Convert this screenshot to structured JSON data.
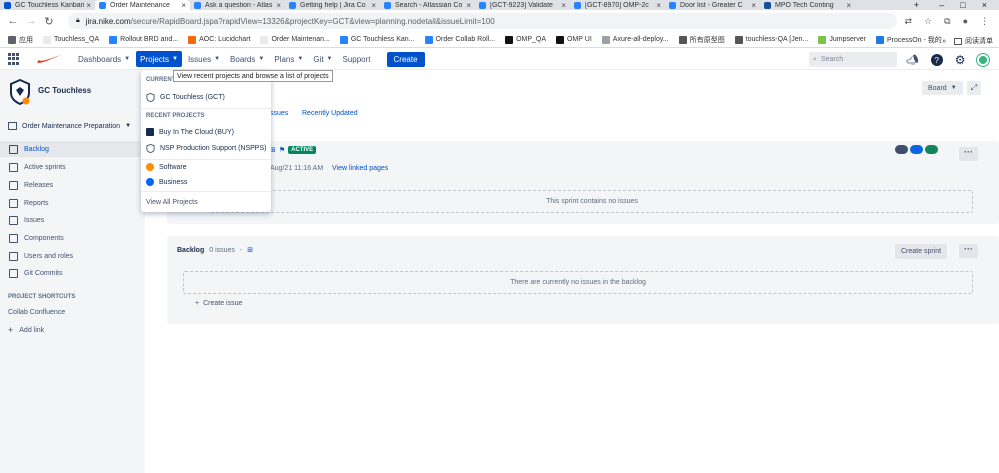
{
  "browser": {
    "tabs": [
      {
        "title": "GC Touchless Kanban",
        "color": "#0052cc",
        "active": false
      },
      {
        "title": "Order Maintenance",
        "color": "#2684ff",
        "active": true
      },
      {
        "title": "Ask a question - Atlas",
        "color": "#2684ff",
        "active": false
      },
      {
        "title": "Getting help | Jira Co",
        "color": "#2684ff",
        "active": false
      },
      {
        "title": "Search - Atlassian Co",
        "color": "#2684ff",
        "active": false
      },
      {
        "title": "[GCT-9223] Validate",
        "color": "#2684ff",
        "active": false
      },
      {
        "title": "[GCT-8970] OMP-2c",
        "color": "#2684ff",
        "active": false
      },
      {
        "title": "Door list - Greater C",
        "color": "#2684ff",
        "active": false
      },
      {
        "title": "MPO Tech Conting",
        "color": "#1a4d99",
        "active": false
      }
    ],
    "new_tab": "+",
    "controls": {
      "minimize": "–",
      "maximize": "□",
      "close": "×"
    },
    "url_host": "jira.nike.com",
    "url_rest": "/secure/RapidBoard.jspa?rapidView=13326&projectKey=GCT&view=planning.nodetail&issueLimit=100",
    "bookmarks": [
      {
        "label": "应用",
        "color": "#5f6368"
      },
      {
        "label": "Touchless_QA",
        "color": "#e8eaed"
      },
      {
        "label": "Rollout BRD and...",
        "color": "#2684ff"
      },
      {
        "label": "AOC: Lucidchart",
        "color": "#f06a0f"
      },
      {
        "label": "Order Maintenan...",
        "color": "#e8eaed"
      },
      {
        "label": "GC Touchless Kan...",
        "color": "#2684ff"
      },
      {
        "label": "Order Collab Roll...",
        "color": "#2684ff"
      },
      {
        "label": "OMP_QA",
        "color": "#111111"
      },
      {
        "label": "OMP UI",
        "color": "#111111"
      },
      {
        "label": "Axure-all-deploy...",
        "color": "#9aa0a6"
      },
      {
        "label": "所有原型图",
        "color": "#555555"
      },
      {
        "label": "touchless-QA [Jen...",
        "color": "#555555"
      },
      {
        "label": "Jumpserver",
        "color": "#7cc24b"
      },
      {
        "label": "ProcessOn - 我的...",
        "color": "#1f7ae0"
      }
    ],
    "more_bookmarks": "»",
    "reading_list": "阅读清单"
  },
  "header": {
    "nav": [
      {
        "label": "Dashboards",
        "active": false
      },
      {
        "label": "Projects",
        "active": true
      },
      {
        "label": "Issues",
        "active": false
      },
      {
        "label": "Boards",
        "active": false
      },
      {
        "label": "Plans",
        "active": false
      },
      {
        "label": "Git",
        "active": false
      },
      {
        "label": "Support",
        "active": false
      }
    ],
    "create_label": "Create",
    "search_placeholder": "Search"
  },
  "tooltip": "View recent projects and browse a list of projects",
  "sidebar": {
    "project_name": "GC Touchless",
    "board_name": "Order Maintenance Preparation",
    "items": [
      {
        "label": "Backlog",
        "selected": true
      },
      {
        "label": "Active sprints",
        "selected": false
      },
      {
        "label": "Releases",
        "selected": false
      },
      {
        "label": "Reports",
        "selected": false
      },
      {
        "label": "Issues",
        "selected": false
      },
      {
        "label": "Components",
        "selected": false
      },
      {
        "label": "Users and roles",
        "selected": false
      },
      {
        "label": "Git Commits",
        "selected": false
      }
    ],
    "shortcuts_title": "PROJECT SHORTCUTS",
    "shortcut": "Collab Confluence",
    "add_link": "Add link"
  },
  "main": {
    "board_button": "Board",
    "filter_issues": "ssues",
    "filter_recent": "Recently Updated",
    "sprint": {
      "status": "ACTIVE",
      "date": "Aug/21 11:16 AM",
      "linked_pages": "View linked pages",
      "empty": "This sprint contains no issues",
      "pills": [
        "#3f4d6e",
        "#0c66e4",
        "#10865a"
      ]
    },
    "backlog": {
      "title": "Backlog",
      "count": "0 issues",
      "create_sprint": "Create sprint",
      "empty": "There are currently no issues in the backlog",
      "create_issue": "Create issue"
    }
  },
  "dropdown": {
    "current_head": "CURRENT PROJECT",
    "current": "GC Touchless (GCT)",
    "recent_head": "RECENT PROJECTS",
    "recent": [
      "Buy In The Cloud (BUY)",
      "NSP Production Support (NSPPS)"
    ],
    "types": [
      {
        "label": "Software",
        "color": "#ff8b00"
      },
      {
        "label": "Business",
        "color": "#0065ff"
      }
    ],
    "view_all": "View All Projects"
  }
}
